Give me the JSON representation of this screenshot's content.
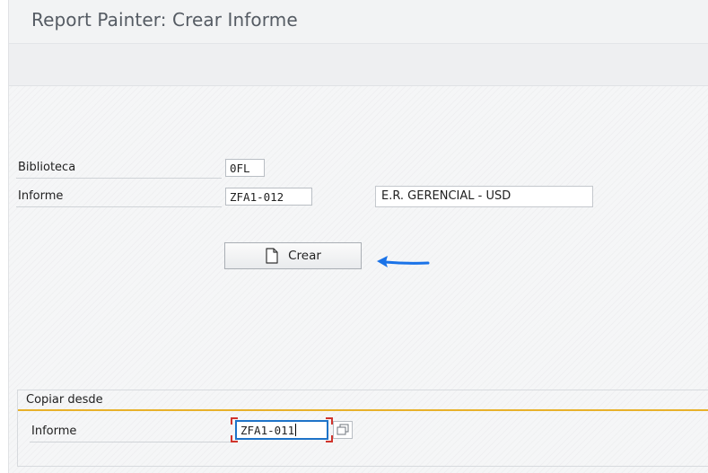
{
  "window": {
    "title": "Report Painter: Crear Informe"
  },
  "form": {
    "biblioteca_label": "Biblioteca",
    "biblioteca_value": "0FL",
    "informe_label": "Informe",
    "informe_value": "ZFA1-012",
    "informe_description": "E.R. GERENCIAL - USD"
  },
  "create_button": {
    "label": "Crear",
    "icon": "document-icon"
  },
  "annotation": {
    "arrow_color": "#1a73e8"
  },
  "copy_section": {
    "title": "Copiar desde",
    "informe_label": "Informe",
    "informe_value": "ZFA1-011",
    "help_icon": "value-help-icon"
  },
  "colors": {
    "accent_line": "#e8b12a",
    "focus_border": "#1e73c8",
    "focus_corners": "#d0342c"
  }
}
